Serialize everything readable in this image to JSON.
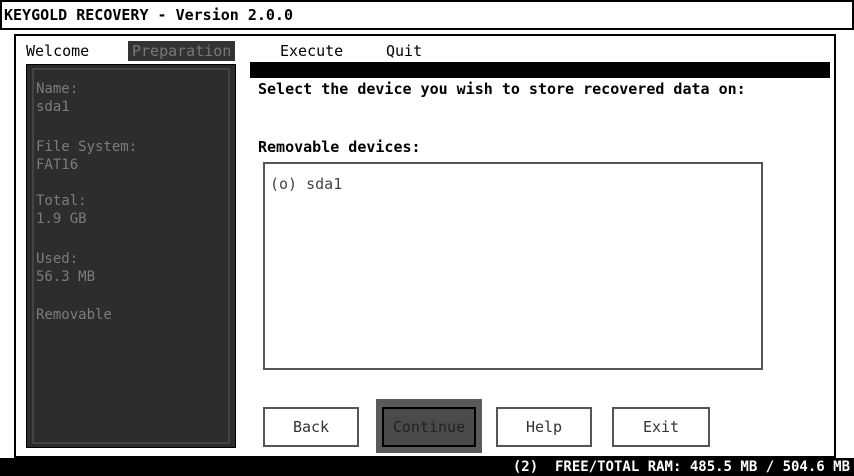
{
  "app": {
    "title": "KEYGOLD RECOVERY - Version 2.0.0"
  },
  "menu": {
    "items": [
      {
        "label": "Welcome"
      },
      {
        "label": "Preparation"
      },
      {
        "label": "Execute"
      },
      {
        "label": "Quit"
      }
    ],
    "selected": "Preparation"
  },
  "sidebar": {
    "name_label": "Name:",
    "name_value": "sda1",
    "fs_label": "File System:",
    "fs_value": "FAT16",
    "total_label": "Total:",
    "total_value": "1.9 GB",
    "used_label": "Used:",
    "used_value": "56.3 MB",
    "type_value": "Removable"
  },
  "main": {
    "prompt": "Select the device you wish to store recovered data on:",
    "devices_label": "Removable devices:",
    "devices": [
      {
        "label": "(o) sda1",
        "selected": true
      }
    ]
  },
  "buttons": {
    "back": "Back",
    "continue": "Continue",
    "help": "Help",
    "exit": "Exit"
  },
  "status": {
    "text": "(2)  FREE/TOTAL RAM: 485.5 MB / 504.6 MB"
  }
}
